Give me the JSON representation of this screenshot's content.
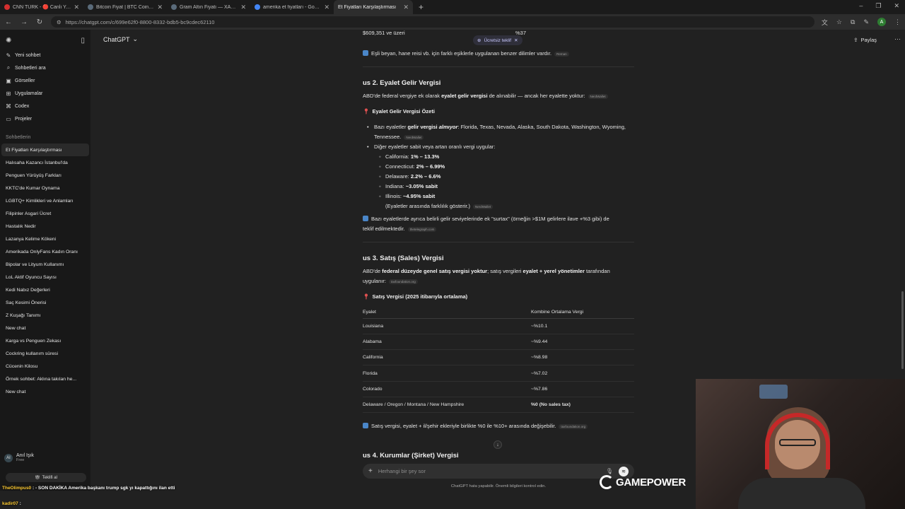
{
  "browser": {
    "tabs": [
      {
        "label": "CNN TÜRK - 🔴 Canlı Yayın",
        "color": "#d32f2f",
        "active": false
      },
      {
        "label": "Bitcoin Fiyat | BTC Coin - Invest",
        "color": "#5a6b7a",
        "active": false
      },
      {
        "label": "Gram Altın Fiyatı — XAUTRYG",
        "color": "#5a6b7a",
        "active": false
      },
      {
        "label": "amerika et fiyatları - Google Sea",
        "color": "#4285f4",
        "active": false
      },
      {
        "label": "Et Fiyatları Karşılaştırması",
        "color": "#2d2d2d",
        "active": true
      }
    ],
    "url": "https://chatgpt.com/c/699e62f0-8800-8332-bdb5-bc9cdec62110"
  },
  "sidebar": {
    "nav": [
      {
        "label": "Yeni sohbet",
        "icon": "edit-icon"
      },
      {
        "label": "Sohbetleri ara",
        "icon": "search-icon"
      },
      {
        "label": "Görseller",
        "icon": "image-icon"
      },
      {
        "label": "Uygulamalar",
        "icon": "apps-icon"
      },
      {
        "label": "Codex",
        "icon": "code-icon"
      },
      {
        "label": "Projeler",
        "icon": "folder-icon"
      }
    ],
    "heading": "Sohbetlerin",
    "chats": [
      "Et Fiyatları Karşılaştırması",
      "Halısaha Kazancı İstanbul'da",
      "Penguen Yürüyüş Farkları",
      "KKTC'de Kumar Oynama",
      "LGBTQ+ Kimlikleri ve Anlamları",
      "Filipinler Asgari Ücret",
      "Hastalık Nedir",
      "Lazanya Kelime Kökeni",
      "Amerikada OnlyFans Kadın Oranı",
      "Bipolar ve Lityum Kullanımı",
      "LoL Aktif Oyuncu Sayısı",
      "Kedi Nabız Değerleri",
      "Saç Kesimi Önerisi",
      "Z Kuşağı Tanımı",
      "New chat",
      "Karga vs Penguen Zekası",
      "Cockring kullanım süresi",
      "Cücenin Kilosu",
      "Örnek sohbet: Aklına takılan he...",
      "New chat"
    ],
    "user": {
      "initials": "AI",
      "name": "Anıl Işık",
      "plan": "Free"
    },
    "offer_button": "Teklifi al"
  },
  "header": {
    "model": "ChatGPT",
    "offer_pill": "Ücretsiz teklif",
    "share": "Paylaş"
  },
  "content": {
    "top_row_left": "$609,351 ve üzeri",
    "top_row_right": "%37",
    "note1": "Eşli beyan, hane reisi vb. için farklı eşiklerle uygulanan benzer dilimler vardır.",
    "note1_cite": "Reman",
    "section2": {
      "title": "us 2. Eyalet Gelir Vergisi",
      "intro_a": "ABD'de federal vergiye ek olarak ",
      "intro_b": "eyalet gelir vergisi",
      "intro_c": " de alınabilir — ancak her eyalette yoktur:",
      "intro_cite": "NerdWallet",
      "summary_title": "Eyalet Gelir Vergisi Özeti",
      "b1_a": "Bazı eyaletler ",
      "b1_b": "gelir vergisi ",
      "b1_c": "almıyor",
      "b1_d": ": Florida, Texas, Nevada, Alaska, South Dakota, Washington, Wyoming,",
      "b1_e": "Tennessee.",
      "b1_cite": "NerdWallet",
      "b2": "Diğer eyaletler sabit veya artan oranlı vergi uygular:",
      "states": [
        {
          "name": "California: ",
          "rate": "1% – 13.3%"
        },
        {
          "name": "Connecticut: ",
          "rate": "2% – 6.99%"
        },
        {
          "name": "Delaware: ",
          "rate": "2.2% – 6.6%"
        },
        {
          "name": "Indiana: ",
          "rate": "~3.05% sabit"
        },
        {
          "name": "Illinois: ",
          "rate": "~4.95% sabit"
        }
      ],
      "states_note": "(Eyaletler arasında farklılık gösterir.)",
      "states_cite": "NerdWallet",
      "surtax_1": "Bazı eyaletlerde ayrıca belirli gelir seviyelerinde ek \"surtax\" (örneğin >$1M gelirlere ilave +%3 gibi) de",
      "surtax_2": "teklif edilmektedir.",
      "surtax_cite": "thetelegraph.com"
    },
    "section3": {
      "title": "us 3. Satış (Sales) Vergisi",
      "intro_a": "ABD'de ",
      "intro_b": "federal düzeyde genel satış vergisi yoktur",
      "intro_c": "; satış vergileri ",
      "intro_d": "eyalet + yerel yönetimler",
      "intro_e": " tarafından",
      "intro_f": "uygulanır:",
      "intro_cite": "taxfoundation.org",
      "table_title": "Satış Vergisi (2025 itibarıyla ortalama)",
      "columns": [
        "Eyalet",
        "Kombine Ortalama Vergi"
      ],
      "rows": [
        [
          "Louisiana",
          "~%10.1"
        ],
        [
          "Alabama",
          "~%9.44"
        ],
        [
          "California",
          "~%8.98"
        ],
        [
          "Florida",
          "~%7.02"
        ],
        [
          "Colorado",
          "~%7.86"
        ],
        [
          "Delaware / Oregon / Montana / New Hampshire",
          "%0 (No sales tax)"
        ]
      ],
      "note": "Satış vergisi, eyalet + il/şehir ekleriyle birlikte %0 ile %10+ arasında değişebilir.",
      "note_cite": "taxfoundation.org"
    },
    "section4_title": "us 4. Kurumlar (Şirket) Vergisi"
  },
  "composer": {
    "placeholder": "Herhangi bir şey sor",
    "disclaimer": "ChatGPT hata yapabilir. Önemli bilgileri kontrol edin."
  },
  "stream": {
    "chat": [
      {
        "user": "TheOlimpus0",
        "text": " : - SON DAKİKA Amerika başkanı trump sgk yı kapattığını ilan etti"
      },
      {
        "user": "kadir07",
        "text": " :"
      }
    ],
    "logo": "GAMEPOWER"
  }
}
